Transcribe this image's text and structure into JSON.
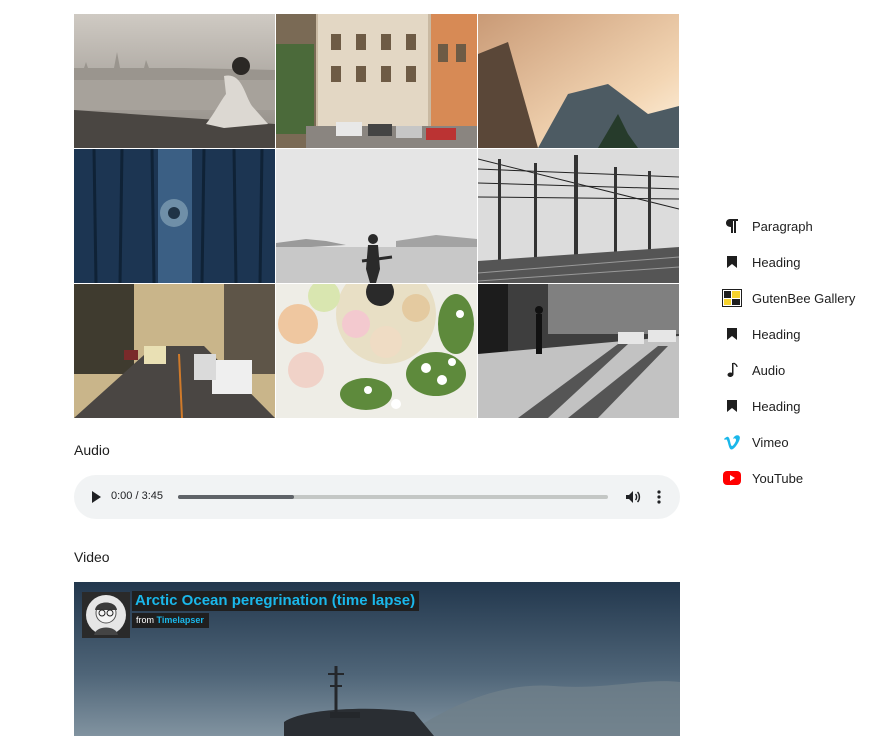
{
  "gallery": {
    "images": [
      {
        "name": "skyline-sitting-man"
      },
      {
        "name": "italian-street"
      },
      {
        "name": "mountain-cliff-sunset"
      },
      {
        "name": "blue-wooden-door-knob"
      },
      {
        "name": "guitarist-on-beach"
      },
      {
        "name": "railway-overhead-lines"
      },
      {
        "name": "city-street-taxis"
      },
      {
        "name": "macarons-and-flowers"
      },
      {
        "name": "pedestrian-street-shadows"
      }
    ]
  },
  "audio": {
    "heading": "Audio",
    "current_time": "0:00",
    "separator": " / ",
    "duration": "3:45",
    "time_display": "0:00 / 3:45",
    "progress_fraction": 0.27
  },
  "video": {
    "heading": "Video",
    "title": "Arctic Ocean peregrination (time lapse)",
    "byline_prefix": "from",
    "author": "Timelapser"
  },
  "block_list": [
    {
      "label": "Paragraph",
      "icon": "paragraph-icon"
    },
    {
      "label": "Heading",
      "icon": "bookmark-icon"
    },
    {
      "label": "GutenBee Gallery",
      "icon": "gutenbee-gallery-icon"
    },
    {
      "label": "Heading",
      "icon": "bookmark-icon"
    },
    {
      "label": "Audio",
      "icon": "music-note-icon"
    },
    {
      "label": "Heading",
      "icon": "bookmark-icon"
    },
    {
      "label": "Vimeo",
      "icon": "vimeo-icon"
    },
    {
      "label": "YouTube",
      "icon": "youtube-icon"
    }
  ],
  "colors": {
    "vimeo": "#1ab7ea",
    "youtube": "#ff0000",
    "player_bg": "#f1f3f4"
  }
}
